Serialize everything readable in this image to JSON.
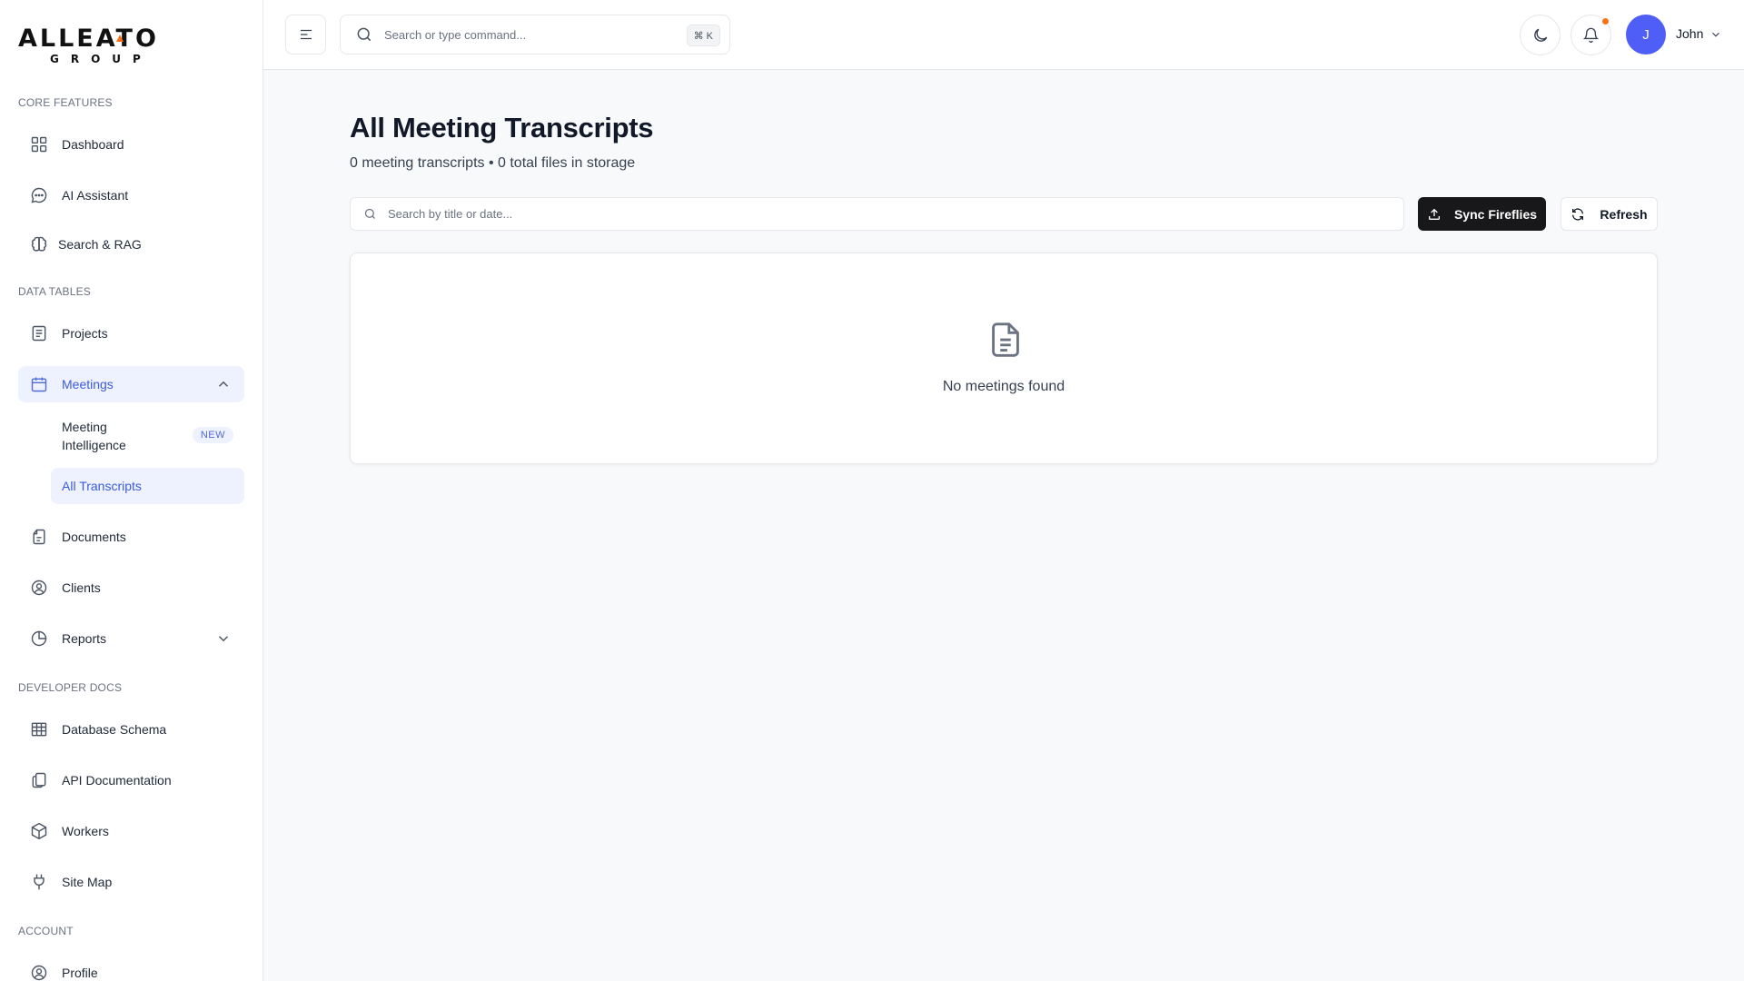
{
  "brand": {
    "logo_top": "ALLEATO",
    "logo_bottom": "GROUP"
  },
  "sidebar": {
    "sections": [
      {
        "label": "CORE FEATURES"
      },
      {
        "label": "DATA TABLES"
      },
      {
        "label": "DEVELOPER DOCS"
      },
      {
        "label": "ACCOUNT"
      }
    ],
    "items": {
      "dashboard": "Dashboard",
      "ai_assistant": "AI Assistant",
      "search_rag": "Search & RAG",
      "projects": "Projects",
      "meetings": "Meetings",
      "meeting_intelligence": "Meeting Intelligence",
      "meeting_intelligence_badge": "NEW",
      "all_transcripts": "All Transcripts",
      "documents": "Documents",
      "clients": "Clients",
      "reports": "Reports",
      "database_schema": "Database Schema",
      "api_documentation": "API Documentation",
      "workers": "Workers",
      "site_map": "Site Map",
      "profile": "Profile"
    }
  },
  "topbar": {
    "search_placeholder": "Search or type command...",
    "shortcut": "⌘ K",
    "user_initial": "J",
    "user_name": "John"
  },
  "main": {
    "title": "All Meeting Transcripts",
    "subtitle": "0 meeting transcripts • 0 total files in storage",
    "search_placeholder": "Search by title or date...",
    "sync_button": "Sync Fireflies",
    "refresh_button": "Refresh",
    "empty_message": "No meetings found"
  },
  "colors": {
    "accent": "#4f5ef7",
    "active_bg": "#eef2ff",
    "notification": "#f97316",
    "primary_button": "#18181b"
  }
}
